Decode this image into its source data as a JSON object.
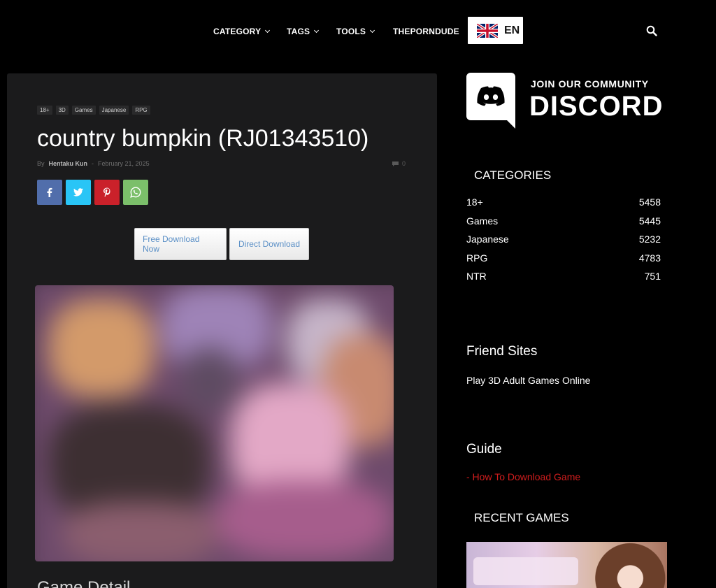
{
  "nav": {
    "items": [
      {
        "label": "CATEGORY",
        "has_dropdown": true
      },
      {
        "label": "TAGS",
        "has_dropdown": true
      },
      {
        "label": "TOOLS",
        "has_dropdown": true
      },
      {
        "label": "THEPORNDUDE",
        "has_dropdown": false
      }
    ],
    "language": "EN",
    "search_icon": "search-icon"
  },
  "post": {
    "tags": [
      "18+",
      "3D",
      "Games",
      "Japanese",
      "RPG"
    ],
    "title": "country bumpkin (RJ01343510)",
    "by_label": "By",
    "author": "Hentaku Kun",
    "date": "February 21, 2025",
    "comment_count": "0",
    "share_buttons": [
      {
        "network": "facebook",
        "glyph": "f",
        "color": "#516eab"
      },
      {
        "network": "twitter",
        "glyph": "t",
        "color": "#29c5f6"
      },
      {
        "network": "pinterest",
        "glyph": "p",
        "color": "#ca212a"
      },
      {
        "network": "whatsapp",
        "glyph": "w",
        "color": "#7bbf6a"
      }
    ],
    "download_buttons": [
      "Free Download Now",
      "Direct Download"
    ],
    "next_heading": "Game Detail"
  },
  "sidebar": {
    "discord": {
      "join": "JOIN OUR COMMUNITY",
      "brand": "DISCORD"
    },
    "categories_heading": "CATEGORIES",
    "categories": [
      {
        "name": "18+",
        "count": "5458"
      },
      {
        "name": "Games",
        "count": "5445"
      },
      {
        "name": "Japanese",
        "count": "5232"
      },
      {
        "name": "RPG",
        "count": "4783"
      },
      {
        "name": "NTR",
        "count": "751"
      }
    ],
    "friend_heading": "Friend Sites",
    "friend_link": "Play 3D Adult Games Online",
    "guide_heading": "Guide",
    "guide_link": "- How To Download Game",
    "recent_heading": "RECENT GAMES"
  }
}
